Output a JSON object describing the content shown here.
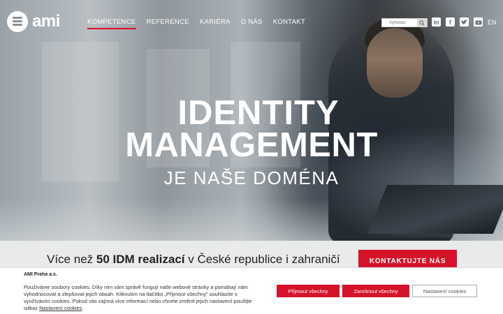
{
  "brand": {
    "logo_text": "ami"
  },
  "nav": {
    "items": [
      {
        "label": "KOMPETENCE",
        "active": true
      },
      {
        "label": "REFERENCE"
      },
      {
        "label": "KARIÉRA"
      },
      {
        "label": "O NÁS"
      },
      {
        "label": "KONTAKT"
      }
    ]
  },
  "search": {
    "placeholder": "Vyhledat"
  },
  "social": {
    "items": [
      "linkedin-icon",
      "facebook-icon",
      "twitter-icon",
      "youtube-icon"
    ]
  },
  "language": {
    "label": "EN"
  },
  "hero": {
    "line1": "IDENTITY",
    "line2": "MANAGEMENT",
    "line3": "JE NAŠE DOMÉNA"
  },
  "band": {
    "text_before": "Více než ",
    "text_bold": "50 IDM realizací",
    "text_after": " v České republice i zahraničí",
    "cta_label": "KONTAKTUJTE NÁS"
  },
  "cookie": {
    "title": "AMI Praha a.s.",
    "text": "Používáme soubory cookies. Díky nim vám správě fungují naše webové stránky a pomáhají nám vyhodnocovat a zlepšovat jejich obsah. Kliknutím na tlačítko „Přijmout všechny\" souhlasíte s využíváním cookies. Pokud vás zajímá více informací nebo chcete změnit jejich nastavení použijte odkaz ",
    "link_label": "Nastavení cookies",
    "text_end": ".",
    "accept_label": "Přijmout všechny",
    "reject_label": "Zamítnout všechny",
    "settings_label": "Nastavení cookies"
  },
  "colors": {
    "accent": "#d5132a",
    "band_bg": "#e9eaea"
  }
}
